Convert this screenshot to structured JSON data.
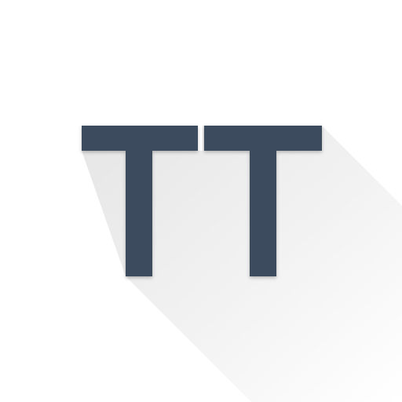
{
  "app_icon": {
    "icon_name": "tt-letters-icon",
    "letters": "TT",
    "colors": {
      "background": "#ffffff",
      "glyph": "#3d4b5f",
      "long_shadow": "#000000"
    }
  }
}
